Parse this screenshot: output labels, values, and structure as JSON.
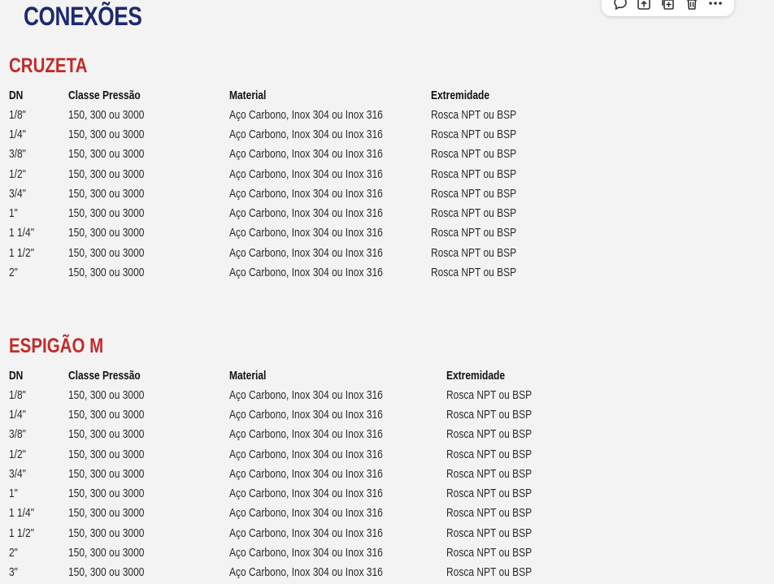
{
  "page": {
    "title": "CONEXÕES"
  },
  "toolbar": {
    "items": [
      {
        "name": "comment-icon"
      },
      {
        "name": "upload-icon"
      },
      {
        "name": "duplicate-icon"
      },
      {
        "name": "trash-icon"
      },
      {
        "name": "more-icon"
      }
    ]
  },
  "sections": [
    {
      "heading": "CRUZETA",
      "columns": [
        "DN",
        "Classe Pressão",
        "Material",
        "Extremidade"
      ],
      "rows": [
        [
          "1/8\"",
          "150, 300 ou 3000",
          "Aço Carbono, Inox 304 ou Inox 316",
          "Rosca NPT ou BSP"
        ],
        [
          "1/4\"",
          "150, 300 ou 3000",
          "Aço Carbono, Inox 304 ou Inox 316",
          "Rosca NPT ou BSP"
        ],
        [
          "3/8\"",
          "150, 300 ou 3000",
          "Aço Carbono, Inox 304 ou Inox 316",
          "Rosca NPT ou BSP"
        ],
        [
          "1/2\"",
          "150, 300 ou 3000",
          "Aço Carbono, Inox 304 ou Inox 316",
          "Rosca NPT ou BSP"
        ],
        [
          "3/4\"",
          "150, 300 ou 3000",
          "Aço Carbono, Inox 304 ou Inox 316",
          "Rosca NPT ou BSP"
        ],
        [
          "1\"",
          "150, 300 ou 3000",
          "Aço Carbono, Inox 304 ou Inox 316",
          "Rosca NPT ou BSP"
        ],
        [
          "1 1/4\"",
          "150, 300 ou 3000",
          "Aço Carbono, Inox 304 ou Inox 316",
          "Rosca NPT ou BSP"
        ],
        [
          "1 1/2\"",
          "150, 300 ou 3000",
          "Aço Carbono, Inox 304 ou Inox 316",
          "Rosca NPT ou BSP"
        ],
        [
          "2\"",
          "150, 300 ou 3000",
          "Aço Carbono, Inox 304 ou Inox 316",
          "Rosca NPT ou BSP"
        ]
      ]
    },
    {
      "heading": "ESPIGÃO M",
      "columns": [
        "DN",
        "Classe Pressão",
        "Material",
        "Extremidade"
      ],
      "rows": [
        [
          "1/8\"",
          "150, 300 ou 3000",
          "Aço Carbono, Inox 304 ou Inox 316",
          "Rosca NPT ou BSP"
        ],
        [
          "1/4\"",
          "150, 300 ou 3000",
          "Aço Carbono, Inox 304 ou Inox 316",
          "Rosca NPT ou BSP"
        ],
        [
          "3/8\"",
          "150, 300 ou 3000",
          "Aço Carbono, Inox 304 ou Inox 316",
          "Rosca NPT ou BSP"
        ],
        [
          "1/2\"",
          "150, 300 ou 3000",
          "Aço Carbono, Inox 304 ou Inox 316",
          "Rosca NPT ou BSP"
        ],
        [
          "3/4\"",
          "150, 300 ou 3000",
          "Aço Carbono, Inox 304 ou Inox 316",
          "Rosca NPT ou BSP"
        ],
        [
          "1\"",
          "150, 300 ou 3000",
          "Aço Carbono, Inox 304 ou Inox 316",
          "Rosca NPT ou BSP"
        ],
        [
          "1 1/4\"",
          "150, 300 ou 3000",
          "Aço Carbono, Inox 304 ou Inox 316",
          "Rosca NPT ou BSP"
        ],
        [
          "1 1/2\"",
          "150, 300 ou 3000",
          "Aço Carbono, Inox 304 ou Inox 316",
          "Rosca NPT ou BSP"
        ],
        [
          "2\"",
          "150, 300 ou 3000",
          "Aço Carbono, Inox 304 ou Inox 316",
          "Rosca NPT ou BSP"
        ],
        [
          "3\"",
          "150, 300 ou 3000",
          "Aço Carbono, Inox 304 ou Inox 316",
          "Rosca NPT ou BSP"
        ]
      ]
    }
  ],
  "colors": {
    "page_title": "#1d2a6e",
    "section_heading": "#c32a2a",
    "background": "#f3f3f3"
  }
}
